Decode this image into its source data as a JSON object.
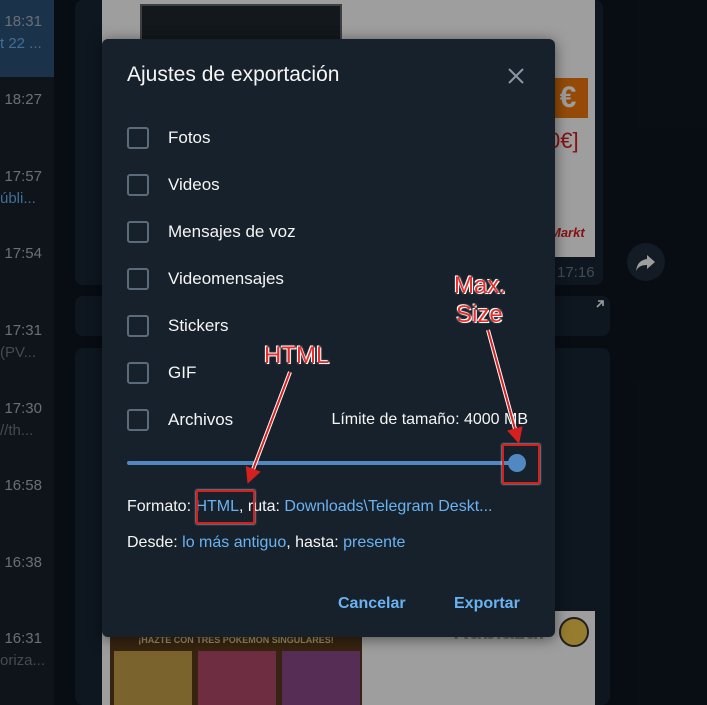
{
  "background": {
    "chat_list": [
      {
        "time": "18:31",
        "preview": "t 22 ..."
      },
      {
        "time": "18:27",
        "preview": ""
      },
      {
        "time": "17:57",
        "preview": "úbli..."
      },
      {
        "time": "17:54",
        "preview": ""
      },
      {
        "time": "17:31",
        "preview": "(PV..."
      },
      {
        "time": "17:30",
        "preview": "//th..."
      },
      {
        "time": "16:58",
        "preview": ""
      },
      {
        "time": "16:38",
        "preview": ""
      },
      {
        "time": "16:31",
        "preview": "oriza..."
      }
    ],
    "message_time": "17:16",
    "ad_price_fragment": "0€]",
    "ad_brand_fragment": "Markt",
    "bottom_card_headline": "¡HAZTE CON TRES POKEMON SINGULARES!",
    "bottom_card_name": "Rubiazul"
  },
  "dialog": {
    "title": "Ajustes de exportación",
    "options": [
      {
        "label": "Fotos",
        "checked": false
      },
      {
        "label": "Videos",
        "checked": false
      },
      {
        "label": "Mensajes de voz",
        "checked": false
      },
      {
        "label": "Videomensajes",
        "checked": false
      },
      {
        "label": "Stickers",
        "checked": false
      },
      {
        "label": "GIF",
        "checked": false
      },
      {
        "label": "Archivos",
        "checked": false
      }
    ],
    "size_limit_label": "Límite de tamaño: 4000 MB",
    "size_slider_fraction": 1.0,
    "format_label": "Formato:",
    "format_value": "HTML",
    "path_label": ", ruta:",
    "path_value": "Downloads\\Telegram Deskt...",
    "from_label": "Desde:",
    "from_value": "lo más antiguo",
    "to_label": ", hasta:",
    "to_value": "presente",
    "cancel_label": "Cancelar",
    "export_label": "Exportar"
  },
  "annotations": {
    "html_label": "HTML",
    "max_size_label_1": "Max.",
    "max_size_label_2": "Size"
  },
  "colors": {
    "accent": "#6ab2f2",
    "slider": "#5288c1",
    "annotation": "#d62020"
  }
}
